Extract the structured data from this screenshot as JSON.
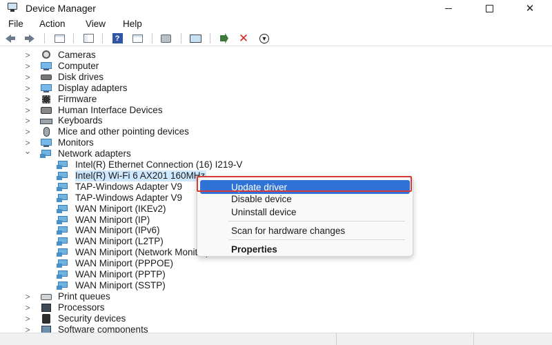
{
  "window": {
    "title": "Device Manager",
    "minimize_glyph": "—",
    "close_glyph": "✕"
  },
  "menu": [
    "File",
    "Action",
    "View",
    "Help"
  ],
  "toolbar": {
    "icons": [
      "back-arrow-icon",
      "forward-arrow-icon",
      "show-hide-console-tree-icon",
      "properties-panel-icon",
      "help-icon",
      "action-pane-icon",
      "print-icon",
      "scan-hardware-icon",
      "update-driver-icon",
      "uninstall-icon",
      "download-icon"
    ]
  },
  "tree": {
    "categories_before": [
      {
        "label": "Cameras",
        "icon": "camera-icon"
      },
      {
        "label": "Computer",
        "icon": "computer-icon"
      },
      {
        "label": "Disk drives",
        "icon": "disk-drive-icon"
      },
      {
        "label": "Display adapters",
        "icon": "display-adapter-icon"
      },
      {
        "label": "Firmware",
        "icon": "firmware-icon"
      },
      {
        "label": "Human Interface Devices",
        "icon": "hid-icon"
      },
      {
        "label": "Keyboards",
        "icon": "keyboard-icon"
      },
      {
        "label": "Mice and other pointing devices",
        "icon": "mouse-icon"
      },
      {
        "label": "Monitors",
        "icon": "monitor-icon"
      },
      {
        "label": "Network adapters",
        "icon": "network-adapter-icon"
      }
    ],
    "network_adapters": [
      "Intel(R) Ethernet Connection (16) I219-V",
      "Intel(R) Wi-Fi 6 AX201 160MHz",
      "TAP-Windows Adapter V9",
      "TAP-Windows Adapter V9",
      "WAN Miniport (IKEv2)",
      "WAN Miniport (IP)",
      "WAN Miniport (IPv6)",
      "WAN Miniport (L2TP)",
      "WAN Miniport (Network Monitor)",
      "WAN Miniport (PPPOE)",
      "WAN Miniport (PPTP)",
      "WAN Miniport (SSTP)"
    ],
    "categories_after": [
      {
        "label": "Print queues",
        "icon": "printer-icon"
      },
      {
        "label": "Processors",
        "icon": "processor-icon"
      },
      {
        "label": "Security devices",
        "icon": "security-device-icon"
      },
      {
        "label": "Software components",
        "icon": "software-component-icon"
      }
    ],
    "collapsed_glyph": ">",
    "expanded_glyph": "⌄"
  },
  "context_menu": {
    "items": [
      {
        "label": "Update driver",
        "highlighted": true
      },
      {
        "label": "Disable device"
      },
      {
        "label": "Uninstall device"
      },
      {
        "label": "Scan for hardware changes"
      },
      {
        "label": "Properties",
        "bold": true
      }
    ],
    "highlight_color": "#2f73d6",
    "annotation_box_color": "#d93a3a"
  }
}
